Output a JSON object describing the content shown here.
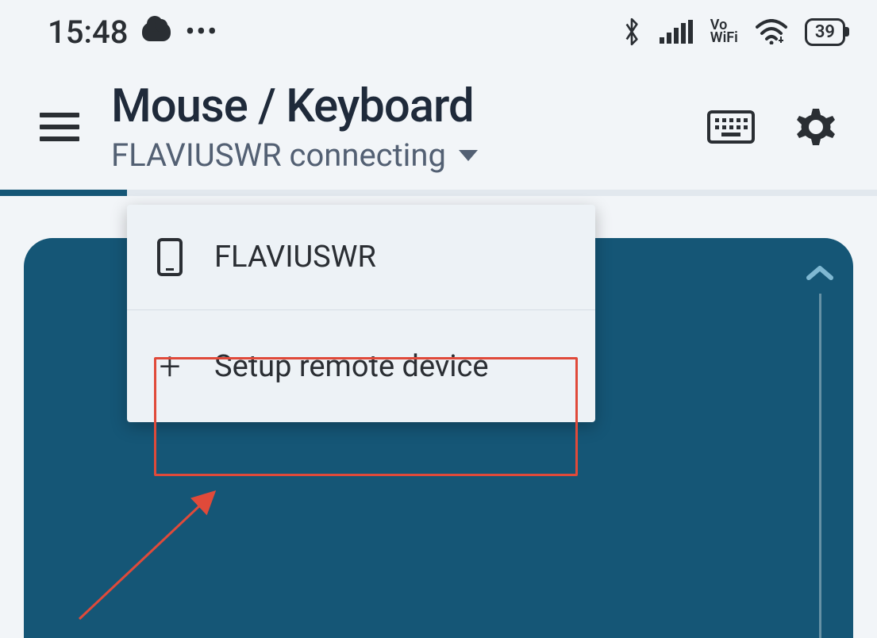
{
  "status_bar": {
    "time": "15:48",
    "vowifi_top": "Vo",
    "vowifi_bottom": "WiFi",
    "battery": "39"
  },
  "header": {
    "title": "Mouse / Keyboard",
    "subtitle": "FLAVIUSWR connecting"
  },
  "dropdown": {
    "device_name": "FLAVIUSWR",
    "setup_label": "Setup remote device"
  }
}
